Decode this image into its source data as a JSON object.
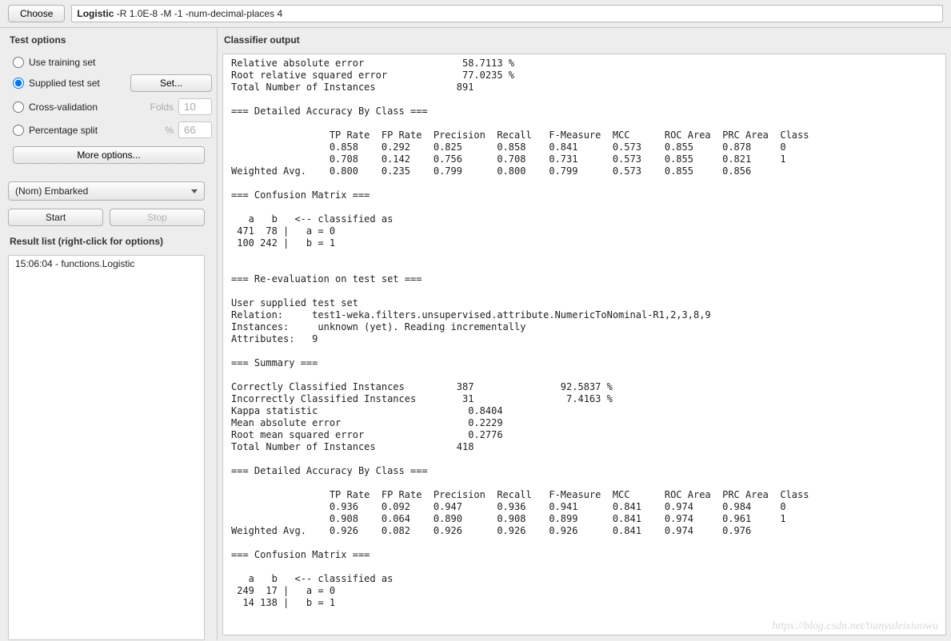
{
  "topbar": {
    "choose_label": "Choose",
    "classifier_name": "Logistic",
    "classifier_args": " -R 1.0E-8 -M -1 -num-decimal-places 4"
  },
  "left": {
    "test_options_title": "Test options",
    "use_training_label": "Use training set",
    "supplied_test_label": "Supplied test set",
    "set_label": "Set...",
    "cross_val_label": "Cross-validation",
    "folds_label": "Folds",
    "folds_value": "10",
    "percentage_label": "Percentage split",
    "pct_sym": "%",
    "pct_value": "66",
    "more_options_label": "More options...",
    "attribute_selected": "(Nom) Embarked",
    "start_label": "Start",
    "stop_label": "Stop",
    "result_list_title": "Result list (right-click for options)",
    "result_item_0": "15:06:04 - functions.Logistic"
  },
  "right": {
    "panel_title": "Classifier output"
  },
  "output_text": "Relative absolute error                 58.7113 %\nRoot relative squared error             77.0235 %\nTotal Number of Instances              891\n\n=== Detailed Accuracy By Class ===\n\n                 TP Rate  FP Rate  Precision  Recall   F-Measure  MCC      ROC Area  PRC Area  Class\n                 0.858    0.292    0.825      0.858    0.841      0.573    0.855     0.878     0\n                 0.708    0.142    0.756      0.708    0.731      0.573    0.855     0.821     1\nWeighted Avg.    0.800    0.235    0.799      0.800    0.799      0.573    0.855     0.856\n\n=== Confusion Matrix ===\n\n   a   b   <-- classified as\n 471  78 |   a = 0\n 100 242 |   b = 1\n\n\n=== Re-evaluation on test set ===\n\nUser supplied test set\nRelation:     test1-weka.filters.unsupervised.attribute.NumericToNominal-R1,2,3,8,9\nInstances:     unknown (yet). Reading incrementally\nAttributes:   9\n\n=== Summary ===\n\nCorrectly Classified Instances         387               92.5837 %\nIncorrectly Classified Instances        31                7.4163 %\nKappa statistic                          0.8404\nMean absolute error                      0.2229\nRoot mean squared error                  0.2776\nTotal Number of Instances              418\n\n=== Detailed Accuracy By Class ===\n\n                 TP Rate  FP Rate  Precision  Recall   F-Measure  MCC      ROC Area  PRC Area  Class\n                 0.936    0.092    0.947      0.936    0.941      0.841    0.974     0.984     0\n                 0.908    0.064    0.890      0.908    0.899      0.841    0.974     0.961     1\nWeighted Avg.    0.926    0.082    0.926      0.926    0.926      0.841    0.974     0.976\n\n=== Confusion Matrix ===\n\n   a   b   <-- classified as\n 249  17 |   a = 0\n  14 138 |   b = 1\n",
  "watermark": "https://blog.csdn.net/tianyaleixiaowu"
}
